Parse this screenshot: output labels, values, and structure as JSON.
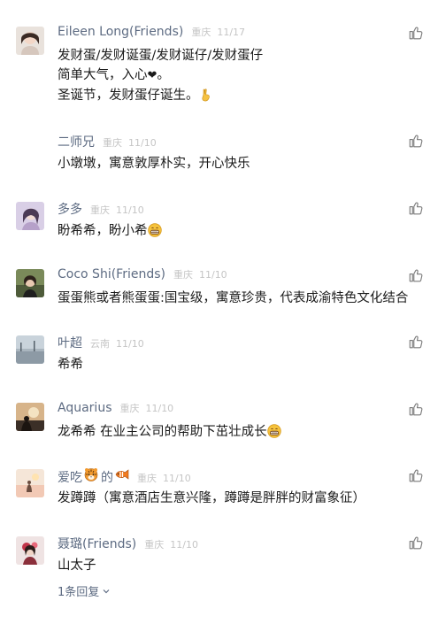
{
  "comments": [
    {
      "name": "Eileen Long(Friends)",
      "location": "重庆",
      "date": "11/17",
      "lines": [
        "发财蛋/发财诞蛋/发财诞仔/发财蛋仔",
        "简单大气，入心",
        "圣诞节，发财蛋仔诞生。"
      ],
      "line2_suffix": "。",
      "line2_icon": "black-heart",
      "line3_icon": "victory-hand-emoji"
    },
    {
      "name": "二师兄",
      "location": "重庆",
      "date": "11/10",
      "lines": [
        "小墩墩，寓意敦厚朴实，开心快乐"
      ]
    },
    {
      "name": "多多",
      "location": "重庆",
      "date": "11/10",
      "lines": [
        "盼希希，盼小希"
      ],
      "line1_icon": "grin-emoji"
    },
    {
      "name": "Coco Shi(Friends)",
      "location": "重庆",
      "date": "11/10",
      "lines": [
        "蛋蛋熊或者熊蛋蛋:国宝级，寓意珍贵，代表成渝特色文化结合"
      ]
    },
    {
      "name": "叶超",
      "location": "云南",
      "date": "11/10",
      "lines": [
        "希希"
      ]
    },
    {
      "name": "Aquarius",
      "location": "重庆",
      "date": "11/10",
      "lines": [
        "龙希希 在业主公司的帮助下茁壮成长"
      ],
      "line1_icon": "grin-emoji"
    },
    {
      "name_parts": [
        "爱吃",
        "的"
      ],
      "name_icons": [
        "tiger-emoji",
        "fish-emoji"
      ],
      "location": "重庆",
      "date": "11/10",
      "lines": [
        "发蹲蹲（寓意酒店生意兴隆，蹲蹲是胖胖的财富象征）"
      ]
    },
    {
      "name": "聂璐(Friends)",
      "location": "重庆",
      "date": "11/10",
      "lines": [
        "山太子"
      ]
    }
  ],
  "reply_link": "1条回复"
}
